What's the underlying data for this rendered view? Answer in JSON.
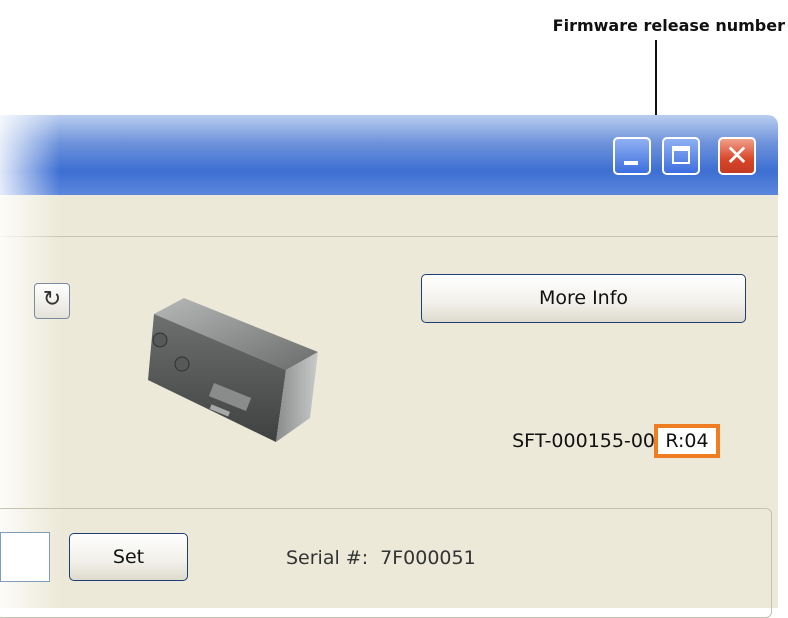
{
  "callout": {
    "label": "Firmware release number",
    "highlight_color": "#ef7d22"
  },
  "window": {
    "controls": {
      "minimize_icon": "minimize-icon",
      "maximize_icon": "maximize-icon",
      "close_icon": "close-icon",
      "close_glyph": "✕"
    }
  },
  "device": {
    "refresh_icon": "refresh-icon",
    "refresh_glyph": "↻",
    "image_icon": "device-image",
    "more_info_label": "More Info",
    "part_number": "SFT-000155-00",
    "release_label": "R:04"
  },
  "serial_section": {
    "set_label": "Set",
    "serial_label": "Serial #:",
    "serial_value": "7F000051"
  }
}
